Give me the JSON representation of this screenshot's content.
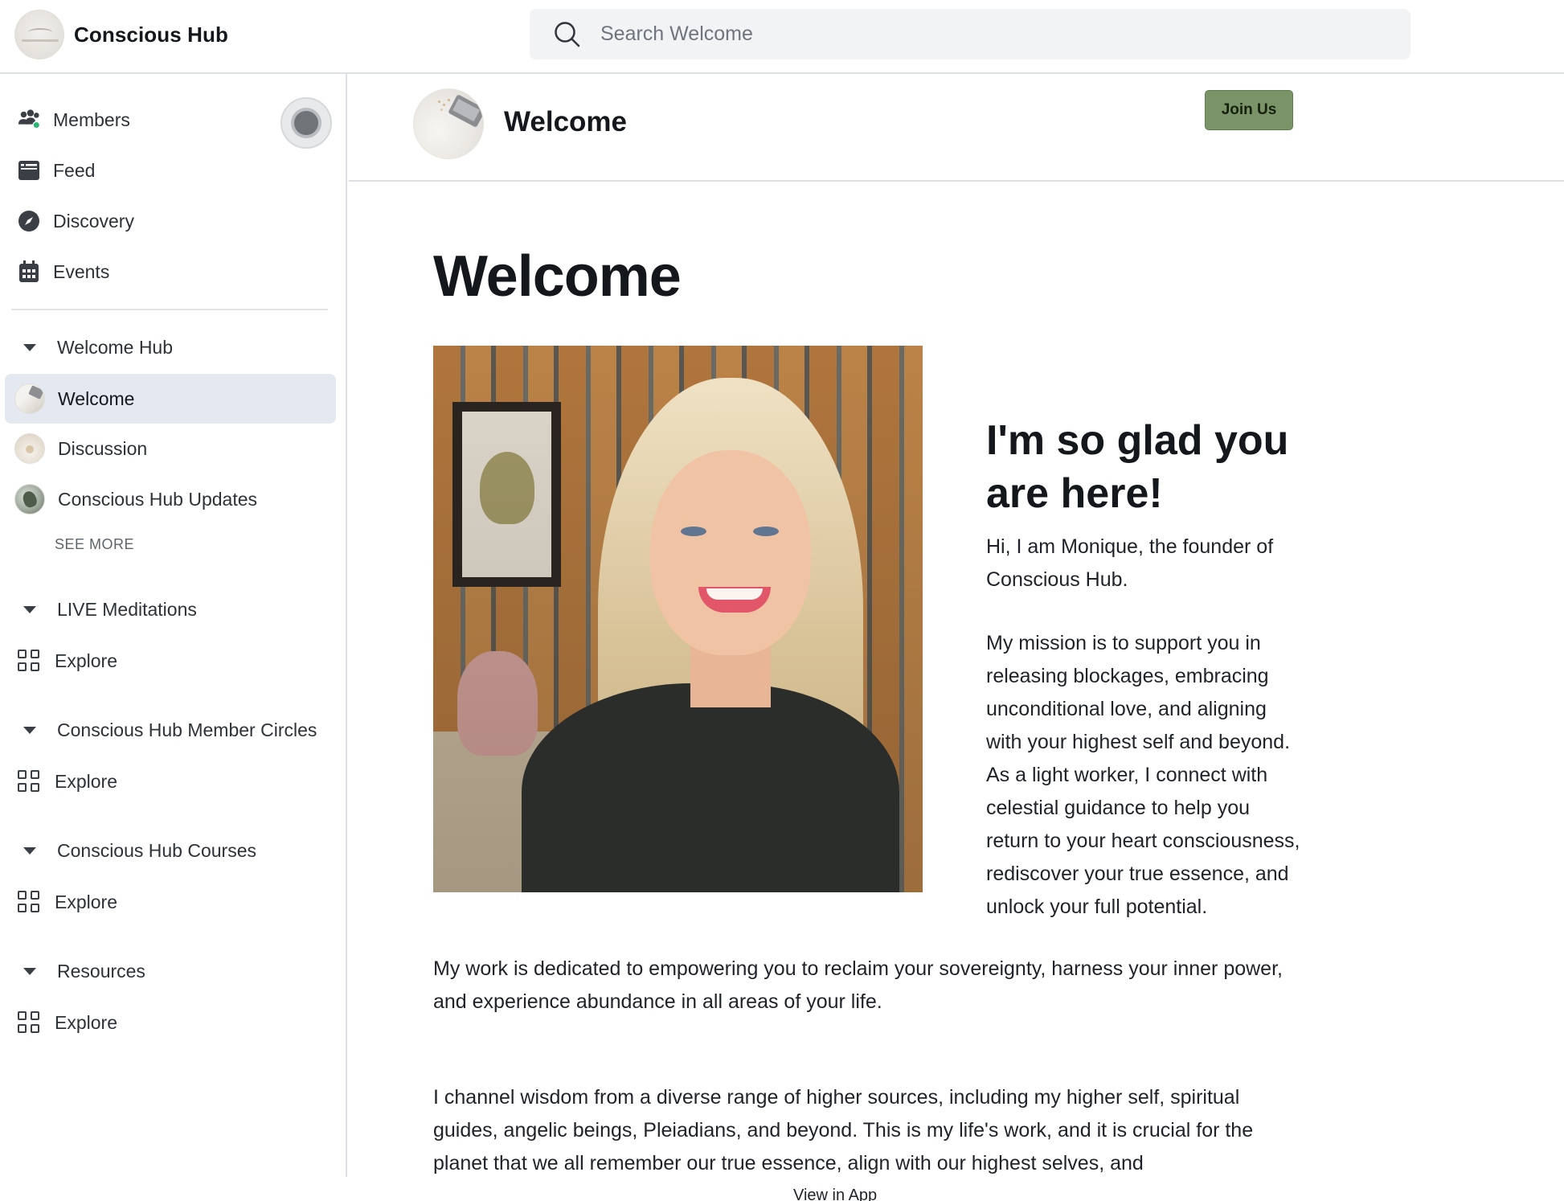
{
  "topbar": {
    "brand_name": "Conscious Hub",
    "search_placeholder": "Search Welcome"
  },
  "sidebar": {
    "nav": [
      {
        "label": "Members",
        "icon": "members-icon"
      },
      {
        "label": "Feed",
        "icon": "feed-icon"
      },
      {
        "label": "Discovery",
        "icon": "compass-icon"
      },
      {
        "label": "Events",
        "icon": "calendar-icon"
      }
    ],
    "online_indicator_color": "#2bb673",
    "sections": [
      {
        "title": "Welcome Hub",
        "items": [
          "Welcome",
          "Discussion",
          "Conscious Hub Updates"
        ],
        "active": "Welcome",
        "see_more": "SEE MORE"
      },
      {
        "title": "LIVE Meditations",
        "explore": "Explore"
      },
      {
        "title": "Conscious Hub Member Circles",
        "explore": "Explore"
      },
      {
        "title": "Conscious Hub Courses",
        "explore": "Explore"
      },
      {
        "title": "Resources",
        "explore": "Explore"
      }
    ]
  },
  "space_header": {
    "title": "Welcome",
    "join_label": "Join Us",
    "join_color": "#7a9467"
  },
  "content": {
    "title": "Welcome",
    "glad_heading": "I'm so glad you are here!",
    "intro": "Hi, I am Monique, the founder of Conscious Hub.",
    "mission": "My mission is to support you in releasing blockages, embracing unconditional love, and aligning with your highest self and beyond. As a light worker, I connect with celestial guidance to help you return to your heart consciousness, rediscover your true essence, and unlock your full potential.",
    "work": "My work is dedicated to empowering you to reclaim your sovereignty, harness your inner power, and experience abundance in all areas of your life.",
    "channel": "I channel wisdom from a diverse range of higher sources, including my higher self, spiritual guides, angelic beings, Pleiadians, and beyond. This is my life's work, and it is crucial for the planet that we all remember our true essence, align with our highest selves, and",
    "view_in_app": "View in App"
  }
}
